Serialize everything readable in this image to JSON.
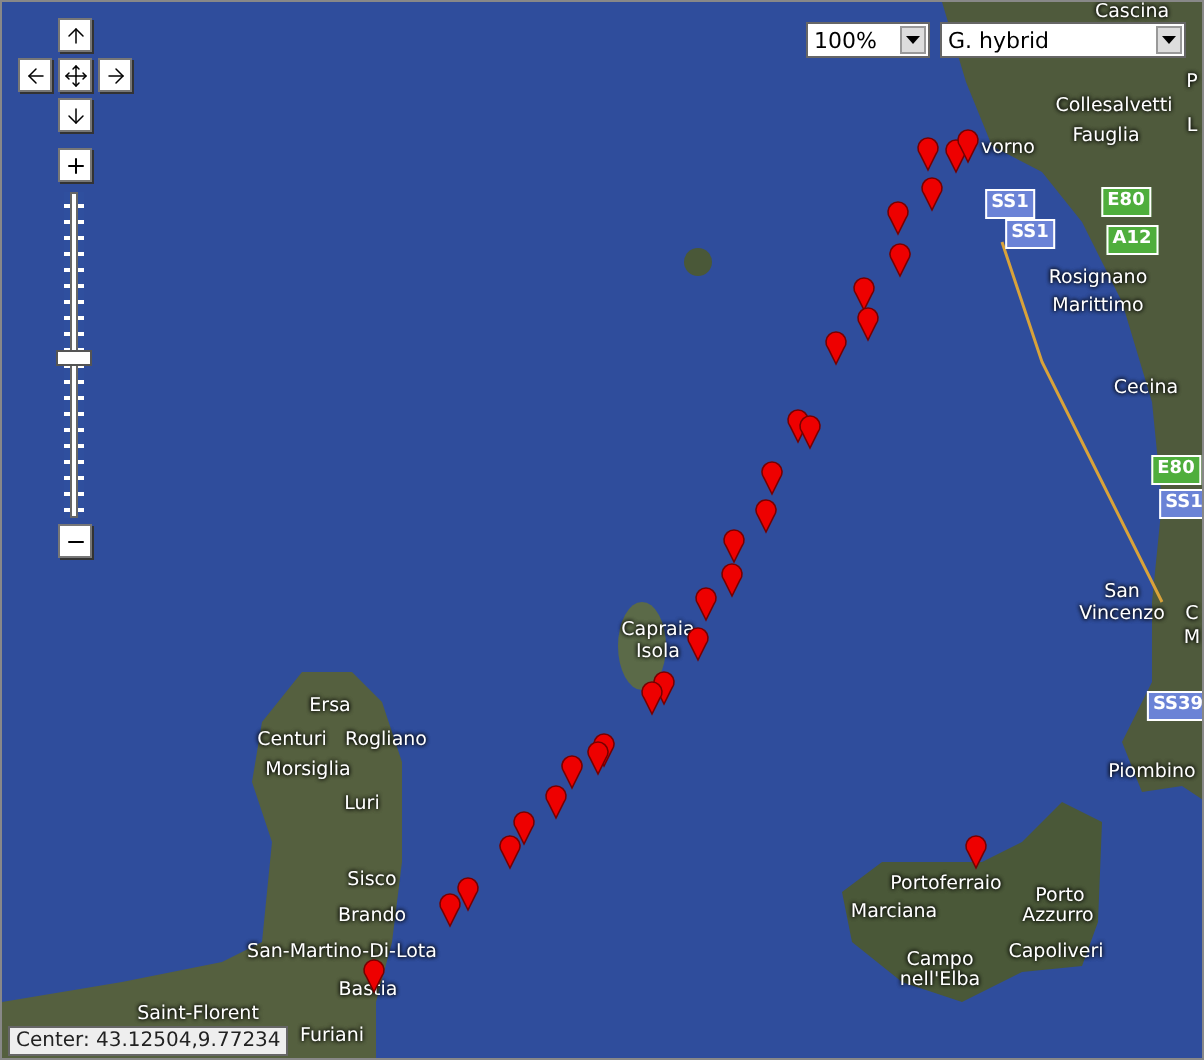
{
  "map_type_controls": [
    {
      "value": "100%"
    },
    {
      "value": "G. hybrid"
    }
  ],
  "zoom_slider": {
    "level": 0.49
  },
  "map_labels": [
    {
      "text": "Cascina",
      "kind": "place"
    },
    {
      "text": "P",
      "kind": "place"
    },
    {
      "text": "Collesalvetti",
      "kind": "place"
    },
    {
      "text": "L",
      "kind": "place"
    },
    {
      "text": "vorno",
      "kind": "place"
    },
    {
      "text": "Fauglia",
      "kind": "place"
    },
    {
      "text": "SS1",
      "kind": "road",
      "color": "#6b83d6"
    },
    {
      "text": "SS1",
      "kind": "road",
      "color": "#6b83d6"
    },
    {
      "text": "E80",
      "kind": "road",
      "color": "#4fae3c"
    },
    {
      "text": "A12",
      "kind": "road",
      "color": "#4fae3c"
    },
    {
      "text": "Rosignano",
      "kind": "place"
    },
    {
      "text": "Marittimo",
      "kind": "place"
    },
    {
      "text": "Cecina",
      "kind": "place"
    },
    {
      "text": "E80",
      "kind": "road",
      "color": "#4fae3c"
    },
    {
      "text": "SS1",
      "kind": "road",
      "color": "#6b83d6"
    },
    {
      "text": "San",
      "kind": "place"
    },
    {
      "text": "Vincenzo",
      "kind": "place"
    },
    {
      "text": "C",
      "kind": "place"
    },
    {
      "text": "M",
      "kind": "place"
    },
    {
      "text": "SS39",
      "kind": "road",
      "color": "#6b83d6"
    },
    {
      "text": "Piombino",
      "kind": "place"
    },
    {
      "text": "Capraia",
      "kind": "place"
    },
    {
      "text": "Isola",
      "kind": "place"
    },
    {
      "text": "Ersa",
      "kind": "place"
    },
    {
      "text": "Centuri",
      "kind": "place"
    },
    {
      "text": "Rogliano",
      "kind": "place"
    },
    {
      "text": "Morsiglia",
      "kind": "place"
    },
    {
      "text": "Luri",
      "kind": "place"
    },
    {
      "text": "Sisco",
      "kind": "place"
    },
    {
      "text": "Brando",
      "kind": "place"
    },
    {
      "text": "San-Martino-Di-Lota",
      "kind": "place"
    },
    {
      "text": "Bastia",
      "kind": "place"
    },
    {
      "text": "Saint-Florent",
      "kind": "place"
    },
    {
      "text": "Furiani",
      "kind": "place"
    },
    {
      "text": "Portoferraio",
      "kind": "place"
    },
    {
      "text": "Marciana",
      "kind": "place"
    },
    {
      "text": "Porto",
      "kind": "place"
    },
    {
      "text": "Azzurro",
      "kind": "place"
    },
    {
      "text": "Campo",
      "kind": "place"
    },
    {
      "text": "nell'Elba",
      "kind": "place"
    },
    {
      "text": "Capoliveri",
      "kind": "place"
    }
  ],
  "status": "Center: 43.12504,9.77234"
}
